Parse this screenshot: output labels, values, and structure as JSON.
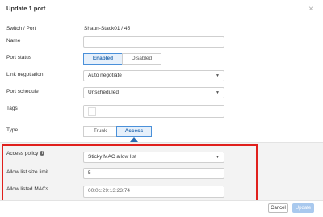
{
  "modal": {
    "title": "Update 1 port",
    "close_glyph": "×"
  },
  "form": {
    "switch_port": {
      "label": "Switch / Port",
      "value": "Shaun-Stack01 / 45"
    },
    "name": {
      "label": "Name",
      "value": ""
    },
    "port_status": {
      "label": "Port status",
      "options": [
        "Enabled",
        "Disabled"
      ],
      "selected": "Enabled"
    },
    "link_negotiation": {
      "label": "Link negotiation",
      "value": "Auto negotiate"
    },
    "port_schedule": {
      "label": "Port schedule",
      "value": "Unscheduled"
    },
    "tags": {
      "label": "Tags",
      "value": "-"
    },
    "type": {
      "label": "Type",
      "options": [
        "Trunk",
        "Access"
      ],
      "selected": "Access"
    }
  },
  "access": {
    "access_policy": {
      "label": "Access policy",
      "value": "Sticky MAC allow list"
    },
    "allow_list_size_limit": {
      "label": "Allow list size limit",
      "value": "5"
    },
    "allow_listed_macs": {
      "label": "Allow listed MACs",
      "value": "00:0c:29:13:23:74"
    }
  },
  "footer": {
    "cancel_label": "Cancel",
    "update_label": "Update"
  },
  "icons": {
    "close": "close-icon",
    "info": "info-icon",
    "caret": "chevron-down-icon"
  },
  "colors": {
    "accent": "#2b6cb0",
    "highlight_box": "#e0201c",
    "update_disabled": "#a9c9ee"
  }
}
